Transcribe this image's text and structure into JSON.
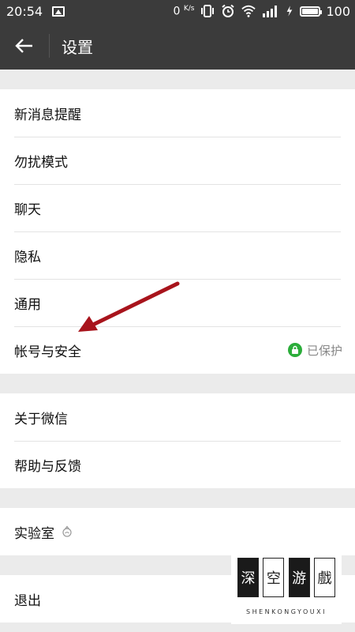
{
  "status_bar": {
    "time": "20:54",
    "net_speed_value": "0",
    "net_speed_unit": "K/s",
    "battery_level": "100"
  },
  "toolbar": {
    "title": "设置"
  },
  "groups": [
    {
      "items": [
        {
          "label": "新消息提醒"
        },
        {
          "label": "勿扰模式"
        },
        {
          "label": "聊天"
        },
        {
          "label": "隐私"
        },
        {
          "label": "通用"
        },
        {
          "label": "帐号与安全",
          "status": "已保护"
        }
      ]
    },
    {
      "items": [
        {
          "label": "关于微信"
        },
        {
          "label": "帮助与反馈"
        }
      ]
    },
    {
      "items": [
        {
          "label": "实验室"
        }
      ]
    },
    {
      "items": [
        {
          "label": "退出"
        }
      ]
    }
  ],
  "watermark": {
    "characters": [
      "深",
      "空",
      "游",
      "戲"
    ],
    "caption": "SHENKONGYOUXI"
  },
  "colors": {
    "toolbar_bg": "#3b3b3b",
    "page_bg": "#ebebeb",
    "secure_green": "#2bad3a",
    "annotation_arrow": "#a8141c"
  }
}
